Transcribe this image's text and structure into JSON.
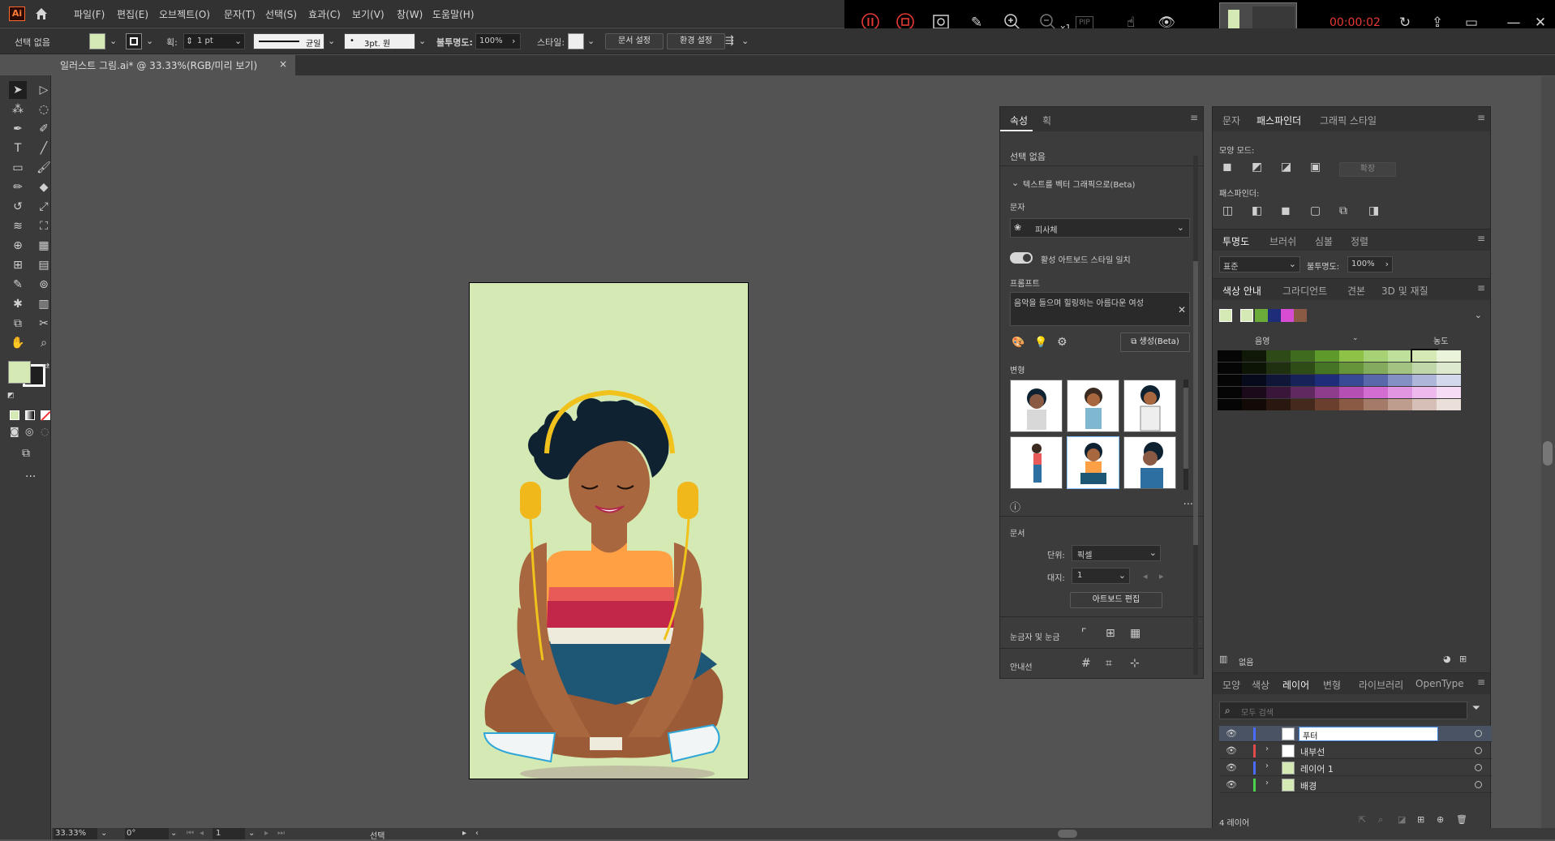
{
  "app": {
    "logo_text": "Ai"
  },
  "menu": [
    "파일(F)",
    "편집(E)",
    "오브젝트(O)",
    "문자(T)",
    "선택(S)",
    "효과(C)",
    "보기(V)",
    "창(W)",
    "도움말(H)"
  ],
  "recorder": {
    "timer": "00:00:02",
    "zoom_label": "x1",
    "pip_label": "PIP"
  },
  "control_bar": {
    "selection": "선택 없음",
    "stroke_label": "획:",
    "stroke_value": "1 pt",
    "stroke_profile": "균일",
    "brush_value": "3pt. 원",
    "opacity_label": "불투명도:",
    "opacity_value": "100%",
    "style_label": "스타일:",
    "doc_setup": "문서 설정",
    "prefs": "환경 설정"
  },
  "document_tab": {
    "title": "일러스트 그림.ai* @ 33.33%(RGB/미리 보기)",
    "close": "×"
  },
  "properties_panel": {
    "tabs": [
      "속성",
      "획"
    ],
    "selection": "선택 없음",
    "text_to_vector": "텍스트를 벡터 그래픽으로(Beta)",
    "subject_label": "문자",
    "subject_value": "피사체",
    "match_style": "활성 아트보드 스타일 일치",
    "prompt_label": "프롬프트",
    "prompt_text": "음악을 들으며 힐링하는 아름다운 여성",
    "generate": "생성(Beta)",
    "variations_label": "변형",
    "document_label": "문서",
    "units_label": "단위:",
    "units_value": "픽셀",
    "artboard_label": "대지:",
    "artboard_value": "1",
    "edit_artboard": "아트보드 편집",
    "rulers_label": "눈금자 및 눈금",
    "guides_label": "안내선"
  },
  "pathfinder_panel": {
    "tabs": [
      "문자",
      "패스파인더",
      "그래픽 스타일"
    ],
    "shape_modes": "모양 모드:",
    "expand": "확장",
    "pathfinders": "패스파인더:"
  },
  "transparency_panel": {
    "tabs": [
      "투명도",
      "브러쉬",
      "심볼",
      "정렬"
    ],
    "blend_mode": "표준",
    "opacity_label": "불투명도:",
    "opacity_value": "100%"
  },
  "color_guide_panel": {
    "tabs": [
      "색상 안내",
      "그라디언트",
      "견본",
      "3D 및 재질"
    ],
    "shade_label": "음영",
    "tint_label": "농도",
    "footer": "없음",
    "base_colors": [
      "#d4e9b4",
      "#6aab3a",
      "#1e2d7a",
      "#d64dd4",
      "#8a5a44"
    ],
    "rows": [
      [
        "#050505",
        "#101808",
        "#2e4a16",
        "#3e6b1d",
        "#5e9a2b",
        "#8dc247",
        "#a6d275",
        "#bfe09a",
        "#d4e9b4",
        "#eaf4db"
      ],
      [
        "#050505",
        "#0c1406",
        "#1e3010",
        "#2e4d16",
        "#457424",
        "#66943b",
        "#83ab5e",
        "#a3c383",
        "#c0d8a9",
        "#dde9cf"
      ],
      [
        "#050505",
        "#070a1a",
        "#0f1638",
        "#172259",
        "#1e2d7a",
        "#394a94",
        "#5968aa",
        "#8490c3",
        "#aeb6da",
        "#d4d8ed"
      ],
      [
        "#050505",
        "#1a0a1a",
        "#3a173a",
        "#60295f",
        "#8e3c8c",
        "#b64fb4",
        "#d46dd2",
        "#e295e0",
        "#eeb9ec",
        "#f7dcf6"
      ],
      [
        "#050505",
        "#120a07",
        "#2a1810",
        "#46291d",
        "#6a3f2e",
        "#8a5a44",
        "#a47a68",
        "#be9c8e",
        "#d5bfb6",
        "#ebdfda"
      ]
    ]
  },
  "layers_panel": {
    "tabs": [
      "모양",
      "색상",
      "레이어",
      "변형",
      "라이브러리",
      "OpenType"
    ],
    "search_placeholder": "모두 검색",
    "layers": [
      {
        "name": "푸터",
        "color": "#4a6bff",
        "selected": true
      },
      {
        "name": "내부선",
        "color": "#e04b4b",
        "selected": false
      },
      {
        "name": "레이어 1",
        "color": "#4a6bff",
        "selected": false
      },
      {
        "name": "배경",
        "color": "#4bd14b",
        "selected": false
      }
    ],
    "count": "4 레이어"
  },
  "status_bar": {
    "zoom": "33.33%",
    "rotation": "0°",
    "artboard": "1",
    "tool": "선택"
  },
  "colors": {
    "fill": "#d4e9b4",
    "artboard_bg": "#d4e9b4"
  }
}
